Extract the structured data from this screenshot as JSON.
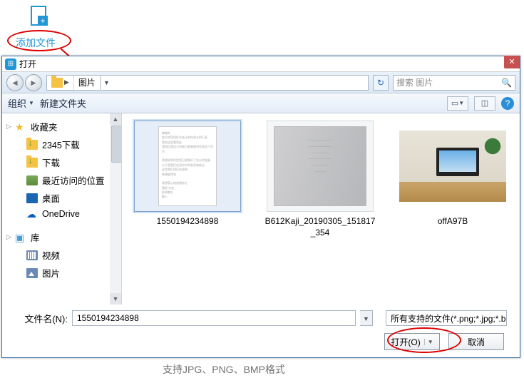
{
  "top": {
    "add_file_label": "添加文件"
  },
  "dialog": {
    "title": "打开",
    "breadcrumb": {
      "segment": "图片"
    },
    "search_placeholder": "搜索 图片",
    "toolbar": {
      "organize": "组织",
      "new_folder": "新建文件夹"
    },
    "sidebar": {
      "favorites": "收藏夹",
      "items_fav": [
        "2345下载",
        "下载",
        "最近访问的位置",
        "桌面",
        "OneDrive"
      ],
      "libraries": "库",
      "items_lib": [
        "视频",
        "图片"
      ]
    },
    "files": [
      {
        "name": "1550194234898"
      },
      {
        "name": "B612Kaji_20190305_151817_354"
      },
      {
        "name": "offA97B"
      }
    ],
    "filename_label": "文件名(N):",
    "filename_value": "1550194234898",
    "filter": "所有支持的文件(*.png;*.jpg;*.b",
    "open_btn": "打开(O)",
    "cancel_btn": "取消"
  },
  "footer": "支持JPG、PNG、BMP格式"
}
